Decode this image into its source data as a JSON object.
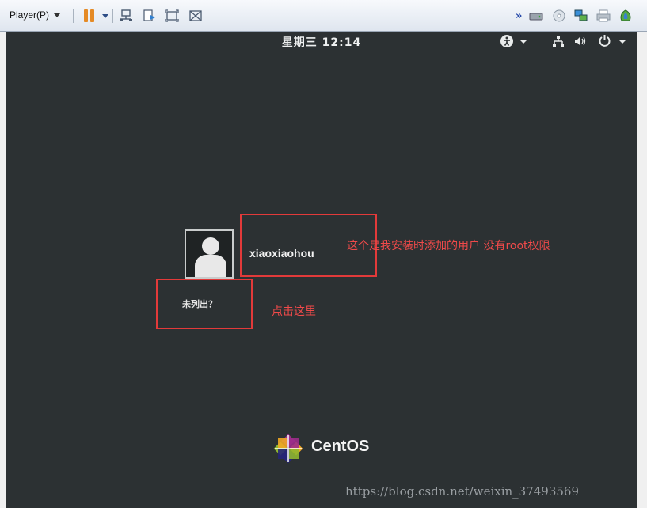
{
  "toolbar": {
    "player_menu": "Player(P)",
    "icons": [
      "pause-icon",
      "send-ctrl-alt-del-icon",
      "unity-icon",
      "fullscreen-icon",
      "disconnect-icon",
      "devices-icon"
    ]
  },
  "topbar": {
    "clock": "星期三 12:14",
    "icons": [
      "accessibility-icon",
      "network-icon",
      "volume-icon",
      "power-icon"
    ]
  },
  "login": {
    "username": "xiaoxiaohou",
    "not_listed": "未列出？"
  },
  "annotations": {
    "user_note": "这个是我安装时添加的用户   没有root权限",
    "click_note": "点击这里"
  },
  "logo": {
    "text": "CentOS"
  },
  "watermark": "https://blog.csdn.net/weixin_37493569",
  "colors": {
    "annotation_red": "#e23a3a",
    "desktop_bg": "#2c3133",
    "pause_orange": "#e58a25"
  }
}
